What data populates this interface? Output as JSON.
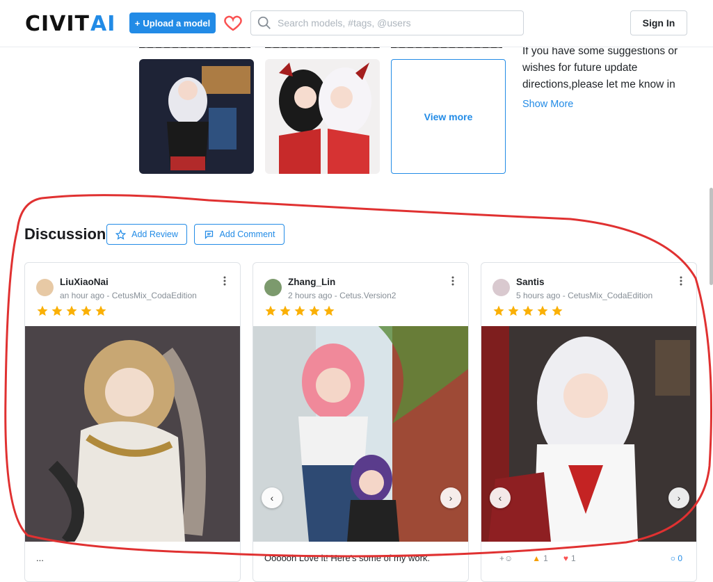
{
  "header": {
    "logo_text": "CIVITAI",
    "upload_label": "Upload a model",
    "search_placeholder": "Search models, #tags, @users",
    "signin_label": "Sign In"
  },
  "gallery": {
    "view_more_label": "View more"
  },
  "description": {
    "text": "If you have some suggestions or wishes for future update directions,please let me know in",
    "show_more_label": "Show More"
  },
  "discussion": {
    "title": "Discussion",
    "add_review_label": "Add Review",
    "add_comment_label": "Add Comment",
    "reviews": [
      {
        "user": "LiuXiaoNai",
        "time": "an hour ago",
        "version": "CetusMix_CodaEdition",
        "rating": 5,
        "footer": "..."
      },
      {
        "user": "Zhang_Lin",
        "time": "2 hours ago",
        "version": "Cetus.Version2",
        "rating": 5,
        "footer": "Oooooh Love it! Here's some of my work."
      },
      {
        "user": "Santis",
        "time": "5 hours ago",
        "version": "CetusMix_CodaEdition",
        "rating": 5,
        "footer": "",
        "reactions": {
          "like": "1",
          "heart": "1",
          "comments": "0"
        }
      }
    ]
  },
  "colors": {
    "accent": "#228be6",
    "star": "#fab005",
    "annotation": "#e03131"
  }
}
